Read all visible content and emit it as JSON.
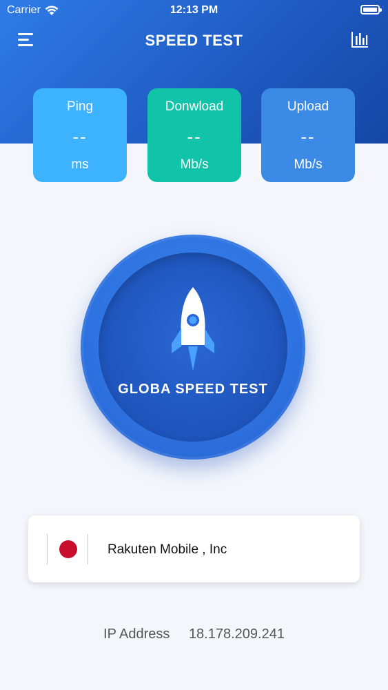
{
  "status_bar": {
    "carrier": "Carrier",
    "time": "12:13 PM"
  },
  "nav": {
    "title": "SPEED TEST",
    "menu_icon": "hamburger-menu-icon",
    "history_icon": "bar-chart-icon"
  },
  "metrics": {
    "ping": {
      "label": "Ping",
      "value": "--",
      "unit": "ms"
    },
    "download": {
      "label": "Donwload",
      "value": "--",
      "unit": "Mb/s"
    },
    "upload": {
      "label": "Upload",
      "value": "--",
      "unit": "Mb/s"
    }
  },
  "start_button": {
    "label": "GLOBA SPEED TEST",
    "icon": "rocket-icon"
  },
  "provider": {
    "name": "Rakuten Mobile , Inc",
    "flag_icon": "japan-flag-icon"
  },
  "ip": {
    "label": "IP Address",
    "value": "18.178.209.241"
  },
  "colors": {
    "header_gradient_start": "#2f7ce6",
    "header_gradient_end": "#1546a6",
    "ping_card": "#3db2ff",
    "download_card": "#10c3a9",
    "upload_card": "#3a8ae6",
    "start_button": "#2d72e0",
    "background": "#f4f6fb"
  }
}
